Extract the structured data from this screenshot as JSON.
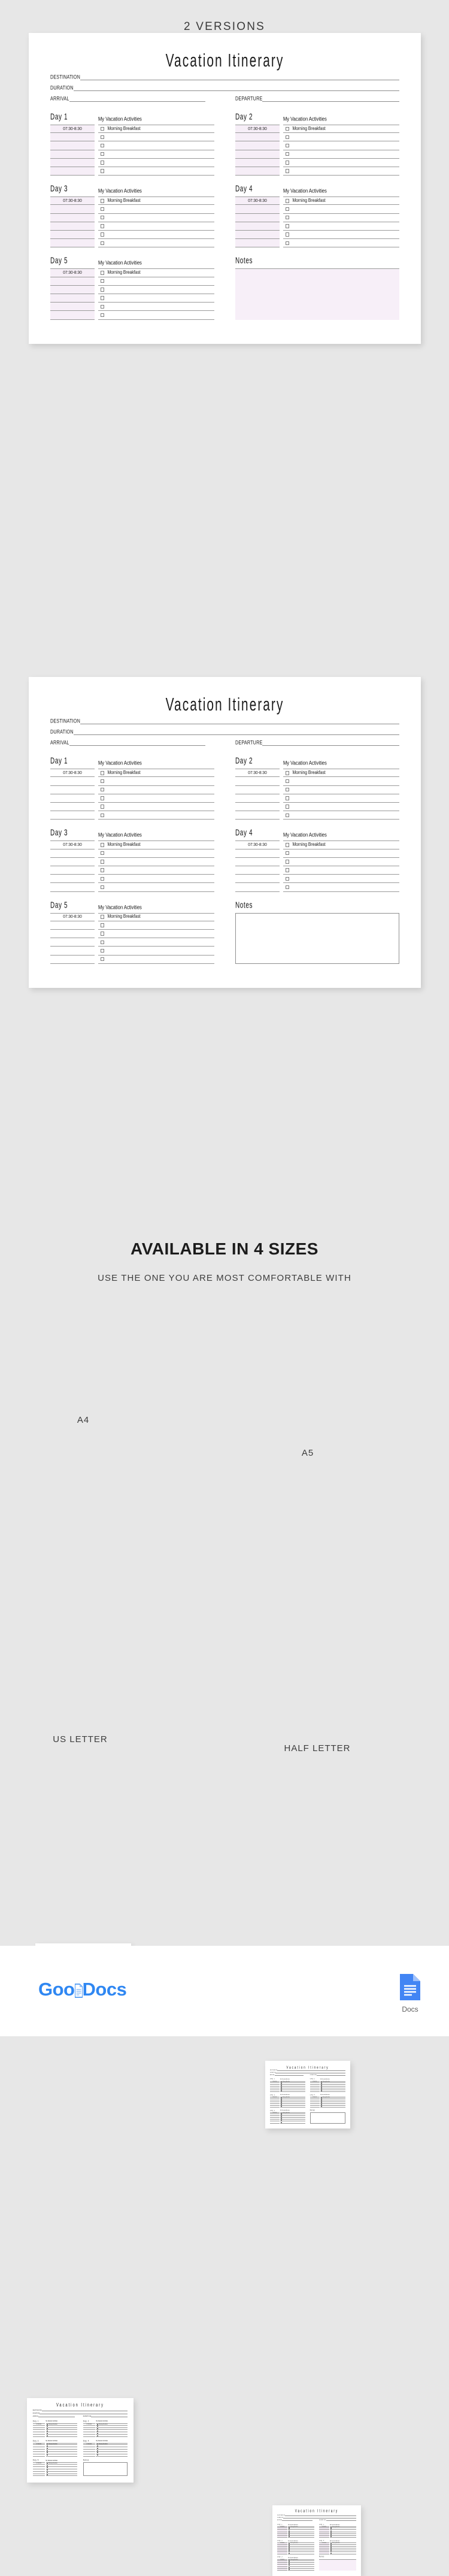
{
  "sections": {
    "versions_heading": "2 VERSIONS",
    "sizes_heading": "AVAILABLE IN 4 SIZES",
    "sizes_subheading": "USE THE ONE YOU ARE MOST COMFORTABLE WITH"
  },
  "document": {
    "title": "Vacation Itinerary",
    "fields": {
      "destination": "DESTINATION",
      "duration": "DURATION",
      "arrival": "ARRIVAL",
      "departure": "DEPARTURE"
    },
    "activities_header": "My Vacation Activities",
    "notes_header": "Notes",
    "default_time": "07:30-8:30",
    "default_activity": "Morning Breakfast",
    "rows_per_day": 6,
    "days": [
      {
        "label": "Day 1"
      },
      {
        "label": "Day 2"
      },
      {
        "label": "Day 3"
      },
      {
        "label": "Day 4"
      },
      {
        "label": "Day 5"
      }
    ]
  },
  "sizes": [
    {
      "label": "A4"
    },
    {
      "label": "A5"
    },
    {
      "label": "US LETTER"
    },
    {
      "label": "HALF LETTER"
    }
  ],
  "footer": {
    "brand_part1": "Goo",
    "brand_part2": "Docs",
    "docs_label": "Docs"
  },
  "colors": {
    "page_background": "#e7e7e7",
    "sheet": "#ffffff",
    "accent_pink": "#f6eef7",
    "rule": "#9a9a9a",
    "brand_blue": "#2f87f2",
    "text": "#1c1c1c"
  }
}
